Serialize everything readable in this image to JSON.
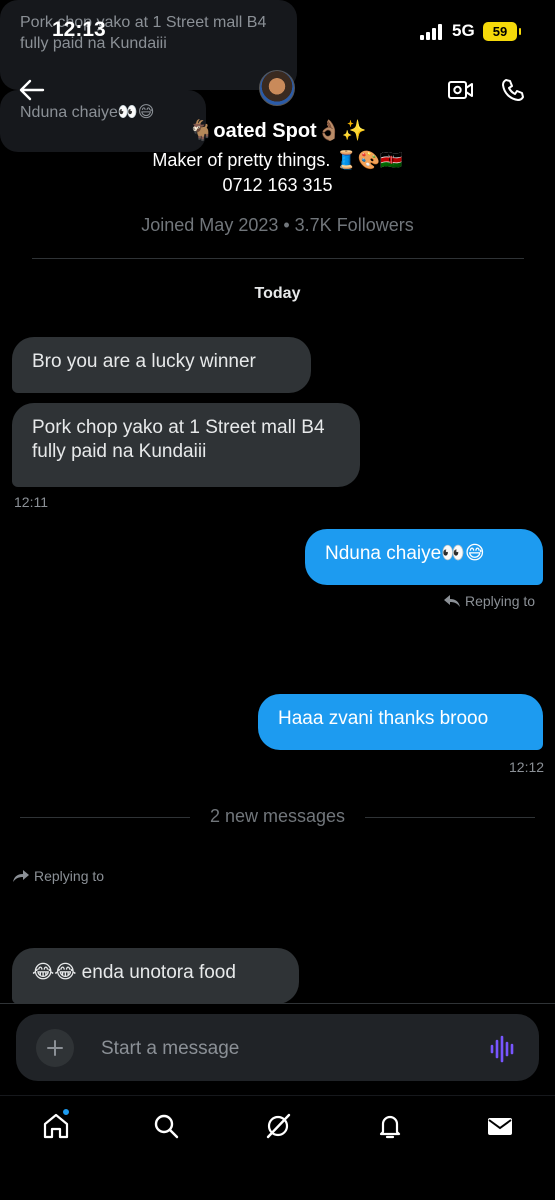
{
  "status": {
    "time": "12:13",
    "network": "5G",
    "battery": "59"
  },
  "header": {
    "name": "🐐oated Spot👌🏽✨",
    "bio": "Maker of pretty things. 🧵🎨🇰🇪",
    "phone": "0712 163 315",
    "meta": "Joined May 2023 • 3.7K Followers"
  },
  "conversation": {
    "day_label": "Today",
    "msg1": "Bro you are a lucky winner",
    "msg2": "Pork chop yako at 1 Street mall B4 fully paid na Kundaiii",
    "time1": "12:11",
    "msg3": "Nduna chaiye👀😅",
    "reply_label_out": "Replying to",
    "quoted_out": "Pork chop yako at 1 Street mall B4 fully paid na Kundaiii",
    "msg4": "Haaa zvani thanks brooo",
    "time2": "12:12",
    "new_messages": "2 new messages",
    "reply_label_in": "Replying to",
    "quoted_in": "Nduna chaiye👀😅",
    "msg5": "😂😂 enda unotora food"
  },
  "composer": {
    "placeholder": "Start a message"
  },
  "tabs": [
    "home-icon",
    "search-icon",
    "grok-icon",
    "notifications-icon",
    "messages-icon"
  ],
  "colors": {
    "accent": "#1d9bf0",
    "incoming_bubble": "#2f3336",
    "voice": "#7856ff"
  }
}
